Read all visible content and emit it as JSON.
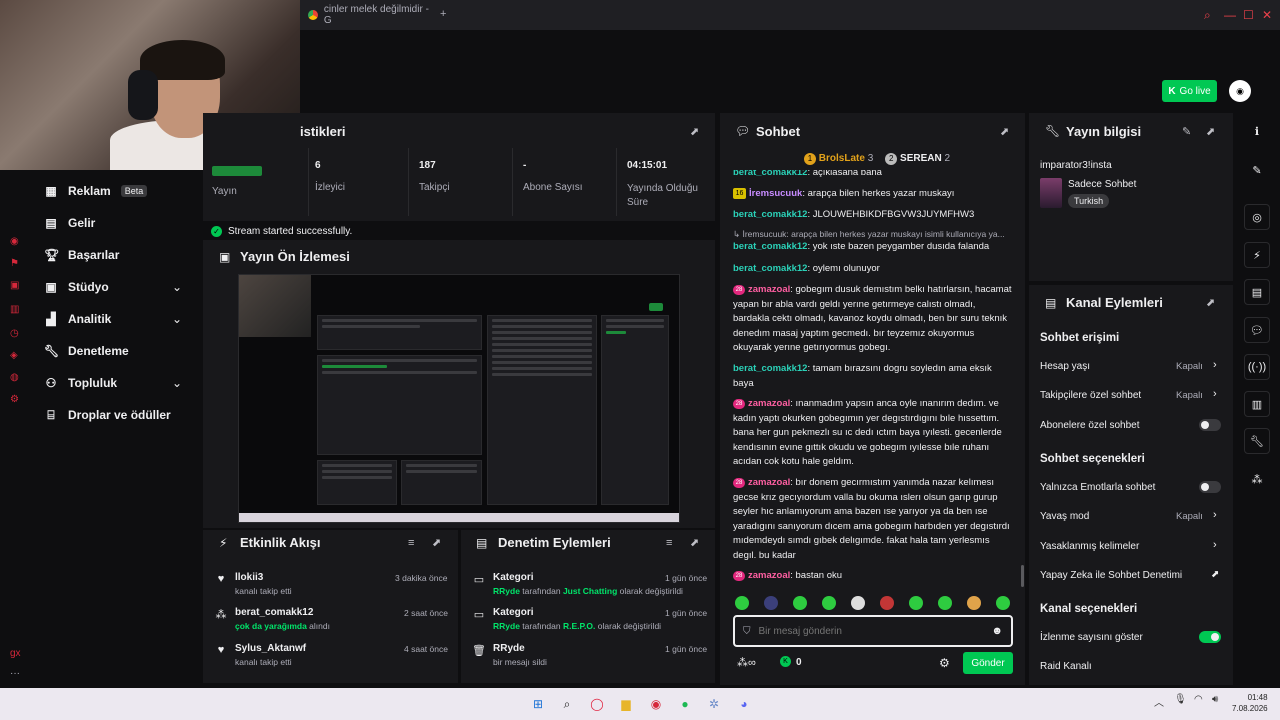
{
  "browser": {
    "tab_title": "cinler melek değilmidir - G",
    "tab_add": "+"
  },
  "header": {
    "go_live": "Go live"
  },
  "sidebar": {
    "items": [
      {
        "label": "Reklam",
        "badge": "Beta",
        "icon": "ad-icon"
      },
      {
        "label": "Gelir",
        "icon": "revenue-icon"
      },
      {
        "label": "Başarılar",
        "icon": "trophy-icon"
      },
      {
        "label": "Stüdyo",
        "icon": "studio-icon",
        "expandable": true
      },
      {
        "label": "Analitik",
        "icon": "analytics-icon",
        "expandable": true
      },
      {
        "label": "Denetleme",
        "icon": "wrench-icon"
      },
      {
        "label": "Topluluk",
        "icon": "community-icon",
        "expandable": true
      },
      {
        "label": "Droplar ve ödüller",
        "icon": "gift-icon"
      }
    ]
  },
  "stats": {
    "title": "istikleri",
    "partial_label": "Yayın",
    "items": [
      {
        "value": "6",
        "label": "İzleyici"
      },
      {
        "value": "187",
        "label": "Takipçi"
      },
      {
        "value": "-",
        "label": "Abone Sayısı"
      },
      {
        "value": "04:15:01",
        "label": "Yayında Olduğu Süre"
      }
    ],
    "status": "Stream started successfully."
  },
  "preview": {
    "title": "Yayın Ön İzlemesi"
  },
  "activity": {
    "title": "Etkinlik Akışı",
    "items": [
      {
        "name": "llokii3",
        "sub": "kanalı takip etti",
        "time": "3 dakika önce",
        "icon": "heart-icon"
      },
      {
        "name": "berat_comakk12",
        "sub_highlight": "çok da yarağımda",
        "sub": " alındı",
        "time": "2 saat önce",
        "icon": "channel-points-icon"
      },
      {
        "name": "Sylus_Aktanwf",
        "sub": "kanalı takip etti",
        "time": "4 saat önce",
        "icon": "heart-icon"
      }
    ]
  },
  "moderation": {
    "title": "Denetim Eylemleri",
    "items": [
      {
        "name": "Kategori",
        "actor": "RRyde",
        "middle": " tarafından ",
        "highlight": "Just Chatting",
        "suffix": " olarak değiştirildi",
        "time": "1 gün önce",
        "icon": "category-icon"
      },
      {
        "name": "Kategori",
        "actor": "RRyde",
        "middle": " tarafından ",
        "highlight": "R.E.P.O.",
        "suffix": " olarak değiştirildi",
        "time": "1 gün önce",
        "icon": "category-icon"
      },
      {
        "name": "RRyde",
        "sub": "bir mesajı sildi",
        "time": "1 gün önce",
        "icon": "trash-icon"
      }
    ]
  },
  "chat": {
    "title": "Sohbet",
    "top_line_user": "berat_comakk12",
    "top_line_text": ": açıklasana bana",
    "leaders": [
      {
        "rank": "1",
        "name": "BrolsLate",
        "count": "3"
      },
      {
        "rank": "2",
        "name": "SEREAN",
        "count": "2"
      }
    ],
    "messages": [
      {
        "user": "berat_comakk12",
        "text": ": JLOUWEHBIKDFBGVW3JUYMFHW3"
      },
      {
        "reply": "↳ İremsucuuk: arapça bilen herkes yazar muskayı isimli kullanıcıya ya..."
      },
      {
        "user": "berat_comakk12",
        "text": ": yok ıste bazen peygamber dusıda falanda"
      },
      {
        "user": "berat_comakk12",
        "text": ": oylemı olunuyor"
      },
      {
        "user": "zamazoal",
        "text": ": gobegım dusuk demıstım belkı hatırlarsın, hacamat yapan bır abla vardı geldı yerıne getırmeye calıstı olmadı, bardakla cektı olmadı, kavanoz koydu olmadı, ben bır suru teknık denedım masaj yaptım gecmedı. bır teyzemız okuyormus okuyarak yerıne getırıyormus gobegı."
      },
      {
        "user": "berat_comakk12",
        "text": ": tamam bırazsını dogru soyledın ama eksık baya"
      },
      {
        "user": "zamazoal",
        "text": ": ınanmadım yapsın anca oyle ınanırım dedım. ve kadın yaptı okurken gobegımın yer degıstırdıgını bıle hıssettım. bana her gun pekmezlı su ıc dedı ıctım baya ıyılesti. gecenlerde kendısının evıne gıttık okudu ve gobegım ıyılesse bıle ruhanı acıdan cok kotu hale geldım."
      },
      {
        "user": "zamazoal",
        "text": ": bır donem gecırmıstım yanımda nazar kelımesı gecse krız gecıyıordum valla bu okuma ıslerı olsun garıp gurup seyler hıc anlamıyorum ama bazen ıse yarıyor ya da ben ıse yaradıgını sanıyorum dıcem ama gobegım harbıden yer degıstırdı mıdemdeydı sımdı gıbek delıgımde. fakat hala tam yerlesmıs degıl. bu kadar"
      },
      {
        "user": "zamazoal",
        "text": ": bastan oku"
      }
    ],
    "pinned_user": "İremsucuuk",
    "pinned_level": "16",
    "pinned_text": ": arapça bilen herkes yazar muskayı",
    "input_placeholder": "Bir mesaj gönderin",
    "points": "0",
    "send": "Gönder"
  },
  "stream_info": {
    "title": "Yayın bilgisi",
    "channel": "imparator3!insta",
    "category": "Sadece Sohbet",
    "tag": "Turkish"
  },
  "channel_actions": {
    "title": "Kanal Eylemleri",
    "chat_access": "Sohbet erişimi",
    "rows_a": [
      {
        "label": "Hesap yaşı",
        "value": "Kapalı",
        "type": "chevron"
      },
      {
        "label": "Takipçilere özel sohbet",
        "value": "Kapalı",
        "type": "chevron"
      },
      {
        "label": "Abonelere özel sohbet",
        "value": "",
        "type": "toggle-off"
      }
    ],
    "chat_options": "Sohbet seçenekleri",
    "rows_b": [
      {
        "label": "Yalnızca Emotlarla sohbet",
        "value": "",
        "type": "toggle-off"
      },
      {
        "label": "Yavaş mod",
        "value": "Kapalı",
        "type": "chevron"
      },
      {
        "label": "Yasaklanmış kelimeler",
        "value": "",
        "type": "chevron"
      },
      {
        "label": "Yapay Zeka ile Sohbet Denetimi",
        "value": "",
        "type": "external"
      }
    ],
    "channel_options": "Kanal seçenekleri",
    "rows_c": [
      {
        "label": "İzlenme sayısını göster",
        "value": "",
        "type": "toggle-on"
      },
      {
        "label": "Raid Kanalı",
        "value": "",
        "type": "none"
      }
    ]
  },
  "taskbar": {
    "time": "01:48",
    "date": "7.08.2026"
  }
}
